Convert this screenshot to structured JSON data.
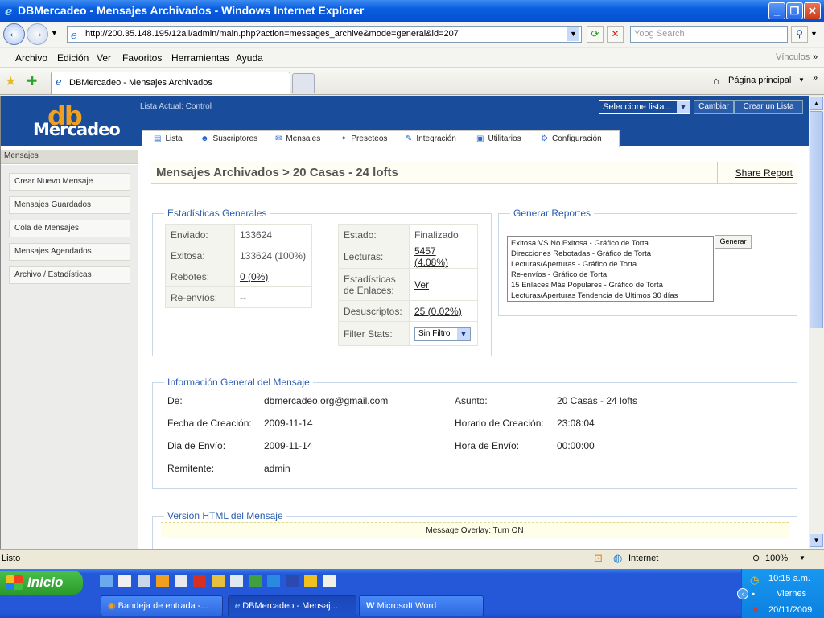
{
  "window": {
    "title": "DBMercadeo - Mensajes Archivados - Windows Internet Explorer",
    "address": "http://200.35.148.195/12all/admin/main.php?action=messages_archive&mode=general&id=207",
    "search_placeholder": "Yoog Search",
    "menu": [
      "Archivo",
      "Edición",
      "Ver",
      "Favoritos",
      "Herramientas",
      "Ayuda"
    ],
    "links_label": "Vínculos",
    "tab_label": "DBMercadeo - Mensajes Archivados",
    "home_label": "Página principal"
  },
  "header": {
    "logo_top": "db",
    "logo_bottom": "Mercadeo",
    "lista_actual": "Lista Actual: Control",
    "select_list": "Seleccione lista...",
    "cambiar": "Cambiar",
    "crear_lista": "Crear un Lista",
    "nav": [
      "Lista",
      "Suscriptores",
      "Mensajes",
      "Preseteos",
      "Integración",
      "Utilitarios",
      "Configuración"
    ]
  },
  "sidebar": {
    "heading": "Mensajes",
    "items": [
      "Crear Nuevo Mensaje",
      "Mensajes Guardados",
      "Cola de Mensajes",
      "Mensajes Agendados",
      "Archivo / Estadísticas"
    ]
  },
  "content": {
    "title": "Mensajes Archivados > 20 Casas - 24 lofts",
    "share": "Share Report",
    "stats": {
      "legend": "Estadísticas Generales",
      "left": [
        {
          "k": "Enviado:",
          "v": "133624"
        },
        {
          "k": "Exitosa:",
          "v": "133624 (100%)"
        },
        {
          "k": "Rebotes:",
          "v": "0 (0%)"
        },
        {
          "k": "Re-envíos:",
          "v": "--"
        }
      ],
      "right": [
        {
          "k": "Estado:",
          "v": "Finalizado"
        },
        {
          "k": "Lecturas:",
          "v": "5457 (4.08%)"
        },
        {
          "k": "Estadísticas de Enlaces:",
          "v": "Ver"
        },
        {
          "k": "Desuscriptos:",
          "v": "25 (0.02%)"
        },
        {
          "k": "Filter Stats:",
          "v": "Sin Filtro"
        }
      ]
    },
    "reports": {
      "legend": "Generar Reportes",
      "options": [
        "Exitosa VS No Exitosa - Gráfico de Torta",
        "Direcciones Rebotadas - Gráfico de Torta",
        "Lecturas/Aperturas - Gráfico de Torta",
        "Re-envíos - Gráfico de Torta",
        "15 Enlaces Más Populares - Gráfico de Torta",
        "Lecturas/Aperturas Tendencia de Ultimos 30 días"
      ],
      "button": "Generar"
    },
    "info": {
      "legend": "Información General del Mensaje",
      "de_k": "De:",
      "de_v": "dbmercadeo.org@gmail.com",
      "asunto_k": "Asunto:",
      "asunto_v": "20 Casas - 24 lofts",
      "fecha_k": "Fecha de Creación:",
      "fecha_v": "2009-11-14",
      "horario_k": "Horario de Creación:",
      "horario_v": "23:08:04",
      "dia_k": "Dia de Envío:",
      "dia_v": "2009-11-14",
      "hora_k": "Hora de Envío:",
      "hora_v": "00:00:00",
      "rem_k": "Remitente:",
      "rem_v": "admin"
    },
    "html_legend": "Versión HTML del Mensaje",
    "overlay_label": "Message Overlay:",
    "overlay_link": "Turn ON"
  },
  "status": {
    "left": "Listo",
    "zone": "Internet",
    "zoom": "100%"
  },
  "taskbar": {
    "start": "Inicio",
    "buttons": [
      "Bandeja de entrada -...",
      "DBMercadeo - Mensaj...",
      "Microsoft Word"
    ],
    "time": "10:15 a.m.",
    "day": "Viernes",
    "date": "20/11/2009"
  }
}
